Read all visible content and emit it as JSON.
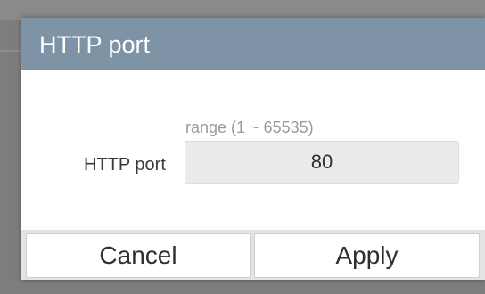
{
  "dialog": {
    "title": "HTTP port",
    "range_hint": "range (1 ~ 65535)",
    "field_label": "HTTP port",
    "port_value": "80",
    "cancel_label": "Cancel",
    "apply_label": "Apply"
  },
  "colors": {
    "header_bg": "#7e93a6",
    "input_bg": "#ebebeb",
    "button_bar_bg": "#e3e3e3",
    "backdrop": "#7d7d7d"
  }
}
